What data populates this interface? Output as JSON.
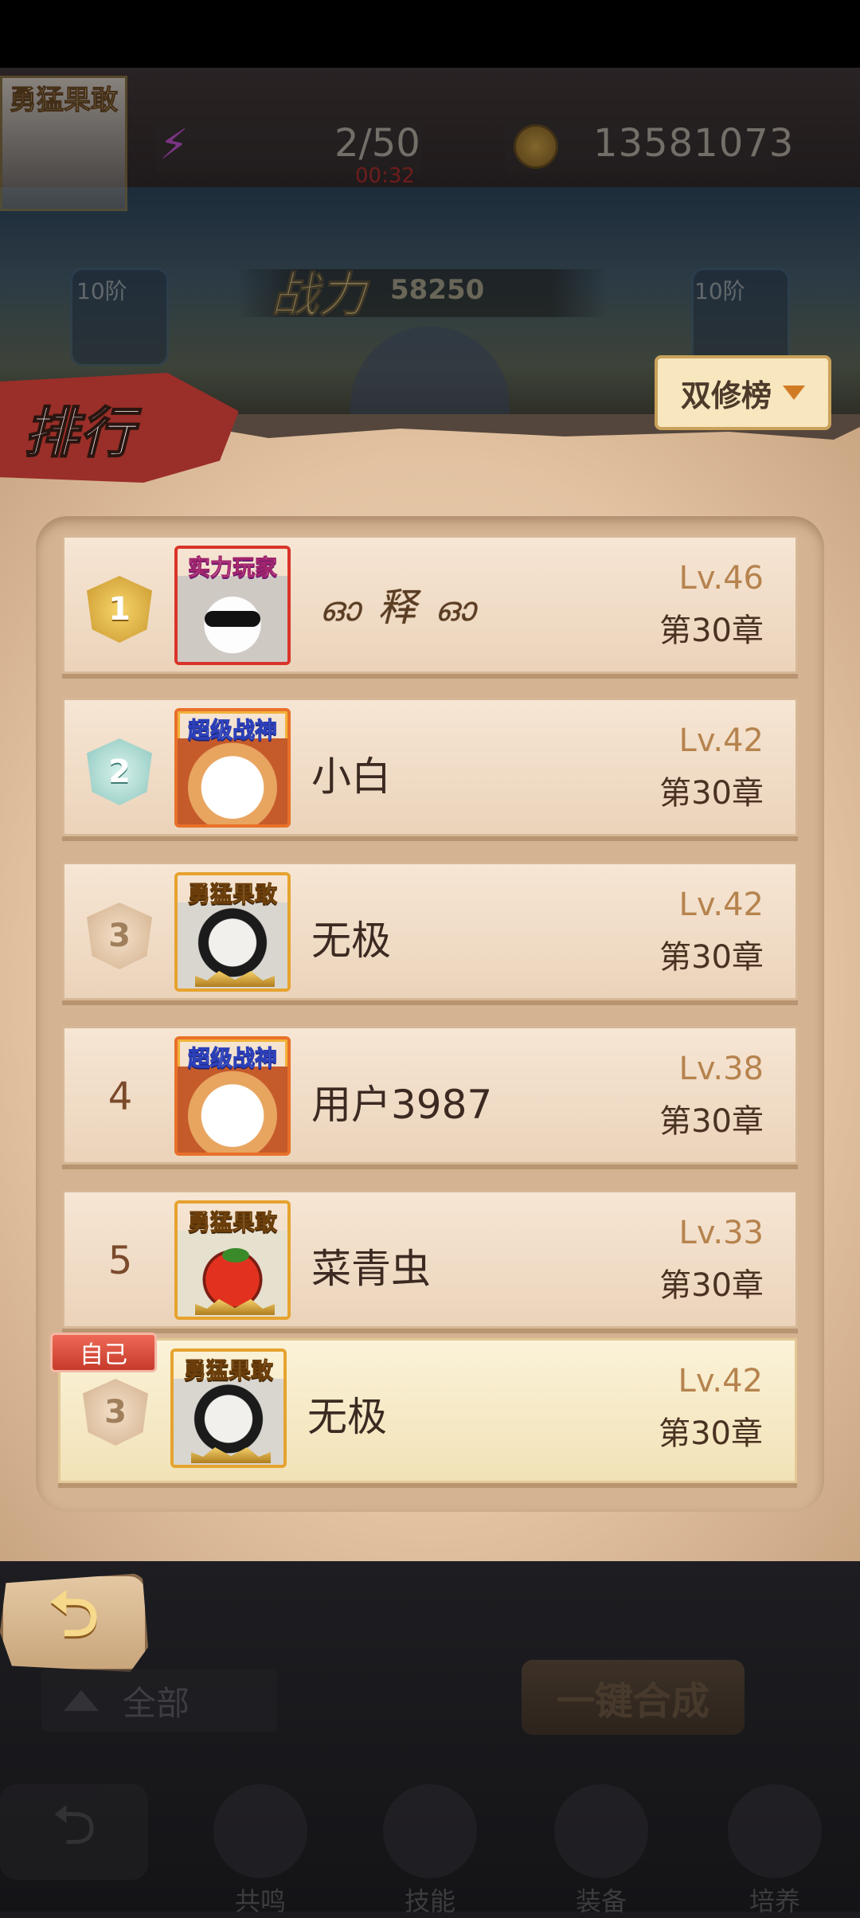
{
  "header": {
    "avatar_title": "勇猛果敢",
    "stamina": "2/50",
    "stamina_timer": "00:32",
    "coins": "13581073",
    "power_label": "战力",
    "power_value": "58250",
    "left_slot_level": "10阶",
    "right_slot_level": "10阶"
  },
  "panel": {
    "title": "排行",
    "dropdown_label": "双修榜"
  },
  "rows": [
    {
      "rank": "1",
      "badge": "gold",
      "title": "实力玩家",
      "name": "释",
      "name_deco_left": "ഓ",
      "name_deco_right": "ഓ",
      "level": "Lv.46",
      "chapter": "第30章"
    },
    {
      "rank": "2",
      "badge": "silver",
      "title": "超级战神",
      "name": "小白",
      "level": "Lv.42",
      "chapter": "第30章"
    },
    {
      "rank": "3",
      "badge": "bronze",
      "title": "勇猛果敢",
      "name": "无极",
      "level": "Lv.42",
      "chapter": "第30章"
    },
    {
      "rank": "4",
      "title": "超级战神",
      "name": "用户3987",
      "level": "Lv.38",
      "chapter": "第30章"
    },
    {
      "rank": "5",
      "title": "勇猛果敢",
      "name": "菜青虫",
      "level": "Lv.33",
      "chapter": "第30章"
    }
  ],
  "self": {
    "tag": "自己",
    "rank": "3",
    "title": "勇猛果敢",
    "name": "无极",
    "level": "Lv.42",
    "chapter": "第30章"
  },
  "controls": {
    "back_icon": "return-arrow-icon",
    "filter_label": "全部",
    "merge_label": "一键合成"
  },
  "nav": [
    "共鸣",
    "技能",
    "装备",
    "培养"
  ],
  "colors": {
    "level": "#b6834e",
    "name": "#3c2a22",
    "self_tag": "#c63a2c",
    "paper": "#e2c2a1"
  }
}
